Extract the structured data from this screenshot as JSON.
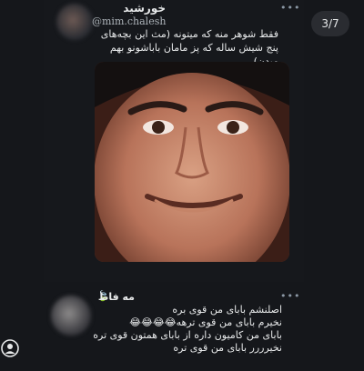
{
  "post": {
    "author_name": "خورشید",
    "handle": "@mim.chalesh",
    "more": "•••",
    "text": "فقط شوهر منه که میتونه (مث این بچه‌های پنج شیش ساله که پز مامان باباشونو بهم میدن)"
  },
  "viewer": {
    "counter": "3/7"
  },
  "reply": {
    "author_name": "مه فاط",
    "author_badge": "🍃",
    "more": "•••",
    "lines": [
      "اصلنشم بابای من قوی بره",
      "نخیرم بابای من قوی ترهه😂😂😂😂",
      "بابای من کامیون داره از بابای همتون قوی تره",
      "نخیرررر بابای من قوی تره"
    ]
  },
  "icons": {
    "more": "more-horizontal-icon",
    "profile": "person-circle-icon",
    "photo": "meme-face-photo"
  }
}
